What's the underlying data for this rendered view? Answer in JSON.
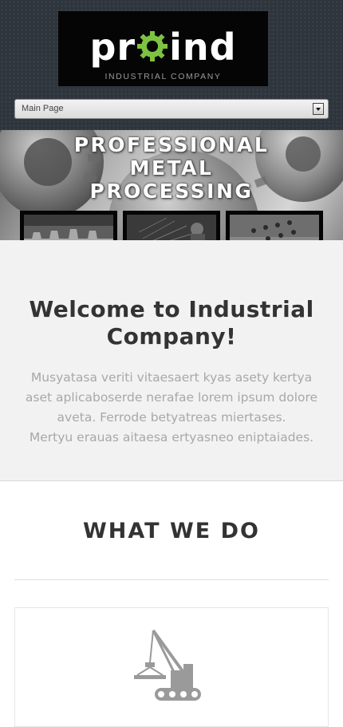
{
  "header": {
    "logo": {
      "word_left": "pr",
      "word_right": "ind",
      "tagline": "INDUSTRIAL COMPANY",
      "gear_color": "#7dc241"
    },
    "nav_select": {
      "selected": "Main Page"
    }
  },
  "hero": {
    "title_lines": [
      "PROFESSIONAL",
      "METAL",
      "PROCESSING"
    ],
    "thumbnails": [
      "gear-teeth",
      "welding-sparks",
      "perforated-metal"
    ]
  },
  "welcome": {
    "title_lines": [
      "Welcome to Industrial",
      "Company!"
    ],
    "paragraph_lines": [
      "Musyatasa veriti vitaesaert kyas asety kertya",
      "aset aplicaboserde nerafae lorem ipsum dolore",
      "aveta. Ferrode betyatreas miertases.",
      "Mertyu erauas aitaesa ertyasneo eniptaiades."
    ]
  },
  "what_we_do": {
    "title": "WHAT WE DO",
    "cards": [
      {
        "icon": "crane-icon"
      }
    ]
  },
  "colors": {
    "header_bg": "#2f353c",
    "accent_green": "#7dc241",
    "welcome_bg": "#f2f2f2",
    "title_text": "#333333",
    "body_text": "#a8a8a8"
  }
}
